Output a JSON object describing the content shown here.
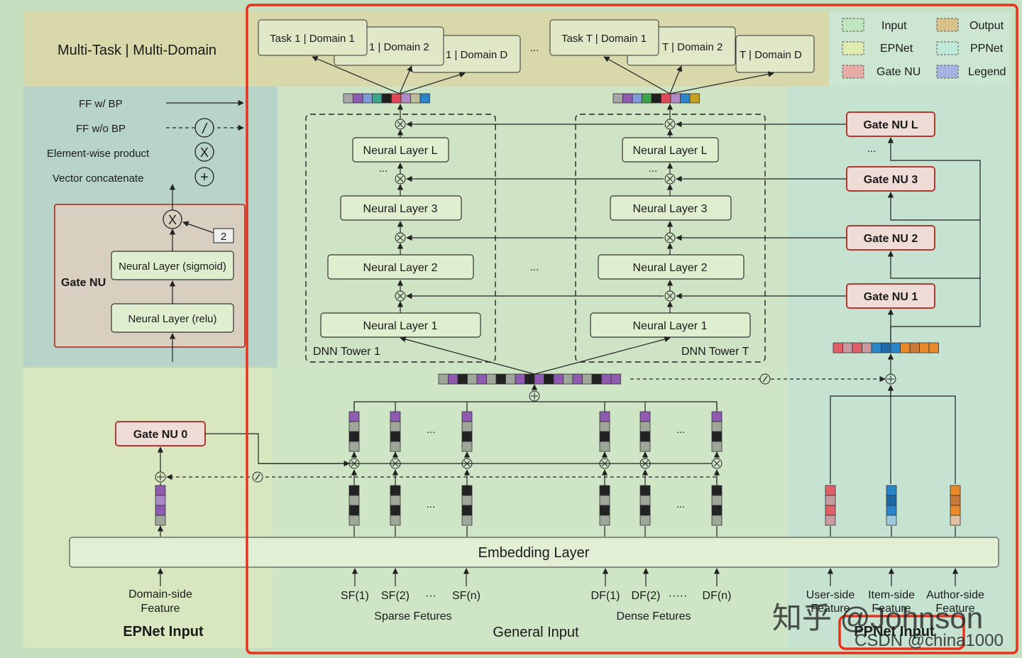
{
  "header": {
    "title": "Multi-Task | Multi-Domain"
  },
  "legend": {
    "items": [
      {
        "label": "Input",
        "color": "#c8e8c8"
      },
      {
        "label": "Output",
        "color": "#d8c08a"
      },
      {
        "label": "EPNet",
        "color": "#dde8b0"
      },
      {
        "label": "PPNet",
        "color": "#c8ece0"
      },
      {
        "label": "Gate NU",
        "color": "#e8b0a8"
      },
      {
        "label": "Legend",
        "color": "#a8b0e0"
      }
    ],
    "ff_bp": "FF w/ BP",
    "ff_nobp": "FF w/o BP",
    "elementwise": "Element-wise product",
    "concat": "Vector concatenate",
    "slash_symbol": "/",
    "times_symbol": "X",
    "plus_symbol": "+"
  },
  "gate_nu_detail": {
    "label": "Gate NU",
    "sigmoid": "Neural Layer (sigmoid)",
    "relu": "Neural Layer (relu)",
    "scale": "2"
  },
  "outputs": {
    "task1": [
      "Task 1 | Domain 1",
      "1 | Domain 2",
      "1 | Domain D"
    ],
    "taskT": [
      "Task T | Domain 1",
      "T | Domain 2",
      "T | Domain D"
    ],
    "ellipsis": "..."
  },
  "towers": {
    "tower1_label": "DNN Tower 1",
    "towerT_label": "DNN Tower T",
    "layers": [
      "Neural Layer L",
      "Neural Layer 3",
      "Neural Layer 2",
      "Neural Layer 1"
    ],
    "ellipsis": "..."
  },
  "gates": [
    "Gate NU L",
    "Gate NU 3",
    "Gate NU 2",
    "Gate NU 1"
  ],
  "gate0": "Gate NU 0",
  "embedding": "Embedding Layer",
  "inputs": {
    "domain_feature": "Domain-side\nFeature",
    "domain_feature_l1": "Domain-side",
    "domain_feature_l2": "Feature",
    "epnet_input": "EPNet Input",
    "sparse": [
      "SF(1)",
      "SF(2)",
      "···",
      "SF(n)"
    ],
    "sparse_label": "Sparse Fetures",
    "dense": [
      "DF(1)",
      "DF(2)",
      "·····",
      "DF(n)"
    ],
    "dense_label": "Dense Fetures",
    "general_input": "General Input",
    "user_l1": "User-side",
    "user_l2": "Feature",
    "item_l1": "Item-side",
    "item_l2": "Feature",
    "author_l1": "Author-side",
    "author_l2": "Feature",
    "ppnet_input": "PPNet Input"
  },
  "watermark": {
    "zhihu": "知乎 @Johnson",
    "csdn": "CSDN @china1000"
  },
  "colors": {
    "highlight_red": "#e8321e",
    "gate_border": "#b03a32",
    "purple": "#8e5bb0",
    "dark": "#222222",
    "gray": "#9ea79a",
    "red_feat": "#e0606a",
    "blue_feat": "#2a86c8",
    "orange_feat": "#e8892a"
  }
}
